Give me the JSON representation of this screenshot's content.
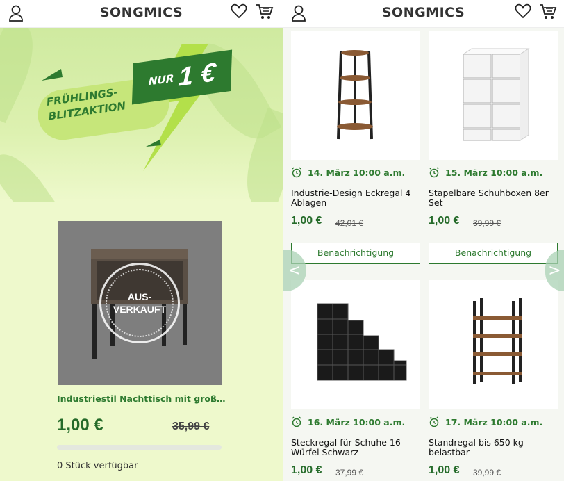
{
  "brand": "SONGMICS",
  "icons": {
    "user": "user-icon",
    "heart": "heart-icon",
    "cart": "cart-icon",
    "alarm": "alarm-clock-icon"
  },
  "colors": {
    "brand_green": "#2d7a2f",
    "banner_bg": "#d8f0a8",
    "lime": "#a8d84a",
    "soldout_gray": "#7e7e7e"
  },
  "left": {
    "banner": {
      "line1": "FRÜHLINGS-",
      "line2": "BLITZAKTION",
      "nur": "NUR",
      "amount": "1 €"
    },
    "product": {
      "soldout_line1": "AUS-",
      "soldout_line2": "VERKAUFT",
      "title": "Industriestil Nachttisch mit großem ...",
      "price": "1,00 €",
      "old_price": "35,99 €",
      "stock": "0 Stück verfügbar",
      "stock_fraction": 0
    }
  },
  "right": {
    "nav_prev": "<",
    "nav_next": ">",
    "products": [
      {
        "date": "14. März 10:00 a.m.",
        "title": "Industrie-Design Eckregal 4 Ablagen",
        "price": "1,00 €",
        "old_price": "42,01 €",
        "button": "Benachrichtigung"
      },
      {
        "date": "15. März 10:00 a.m.",
        "title": "Stapelbare Schuhboxen 8er Set",
        "price": "1,00 €",
        "old_price": "39,99 €",
        "button": "Benachrichtigung"
      },
      {
        "date": "16. März 10:00 a.m.",
        "title": "Steckregal für Schuhe 16 Würfel Schwarz",
        "price": "1,00 €",
        "old_price": "37,99 €"
      },
      {
        "date": "17. März 10:00 a.m.",
        "title": "Standregal bis 650 kg belastbar",
        "price": "1,00 €",
        "old_price": "39,99 €"
      }
    ]
  }
}
